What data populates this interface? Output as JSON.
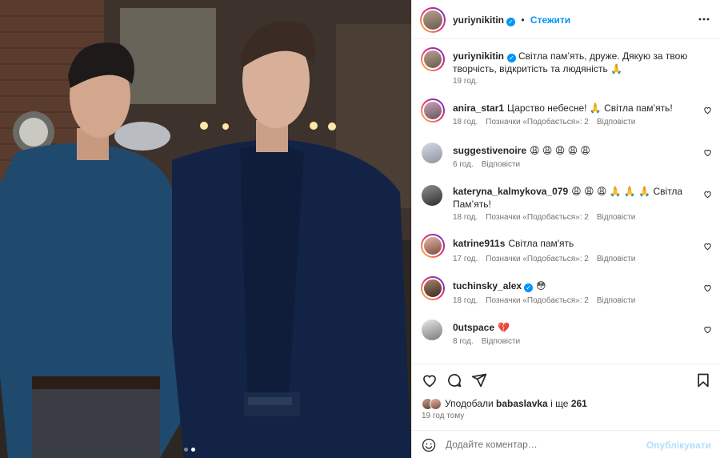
{
  "post": {
    "username": "yuriynikitin",
    "follow_label": "Стежити",
    "more_icon": "more-horizontal-icon",
    "carousel": {
      "slides": 2,
      "active": 2
    }
  },
  "caption": {
    "username": "yuriynikitin",
    "text": "Світла пам’ять, друже. Дякую за твою творчість, відкритість та людяність 🙏",
    "time": "19 год."
  },
  "comments": [
    {
      "username": "anira_star1",
      "text": "Царство небесне! 🙏 Світла пам’ять!",
      "time": "18 год.",
      "likes": "Позначки «Подобається»: 2",
      "reply": "Відповісти",
      "verified": false
    },
    {
      "username": "suggestivenoire",
      "text": "😩 😩 😩 😩 😩",
      "time": "6 год.",
      "likes": "",
      "reply": "Відповісти",
      "verified": false
    },
    {
      "username": "kateryna_kalmykova_079",
      "text": "😩 😩 😩 🙏 🙏 🙏 Світла Пам’ять!",
      "time": "18 год.",
      "likes": "Позначки «Подобається»: 2",
      "reply": "Відповісти",
      "verified": false
    },
    {
      "username": "katrine911s",
      "text": "Світла пам'ять",
      "time": "17 год.",
      "likes": "Позначки «Подобається»: 2",
      "reply": "Відповісти",
      "verified": false
    },
    {
      "username": "tuchinsky_alex",
      "text": "😳",
      "time": "18 год.",
      "likes": "Позначки «Подобається»: 2",
      "reply": "Відповісти",
      "verified": true
    },
    {
      "username": "0utspace",
      "text": "💔",
      "time": "8 год.",
      "likes": "",
      "reply": "Відповісти",
      "verified": false
    }
  ],
  "likes_summary": {
    "prefix": "Уподобали",
    "user": "babaslavka",
    "middle": "і ще",
    "count": "261"
  },
  "posted_ago": "19 год тому",
  "add_comment": {
    "placeholder": "Додайте коментар…",
    "post_label": "Опублікувати"
  },
  "colors": {
    "accent": "#0095f6",
    "muted": "#737373",
    "post_disabled": "#b2dffc"
  }
}
